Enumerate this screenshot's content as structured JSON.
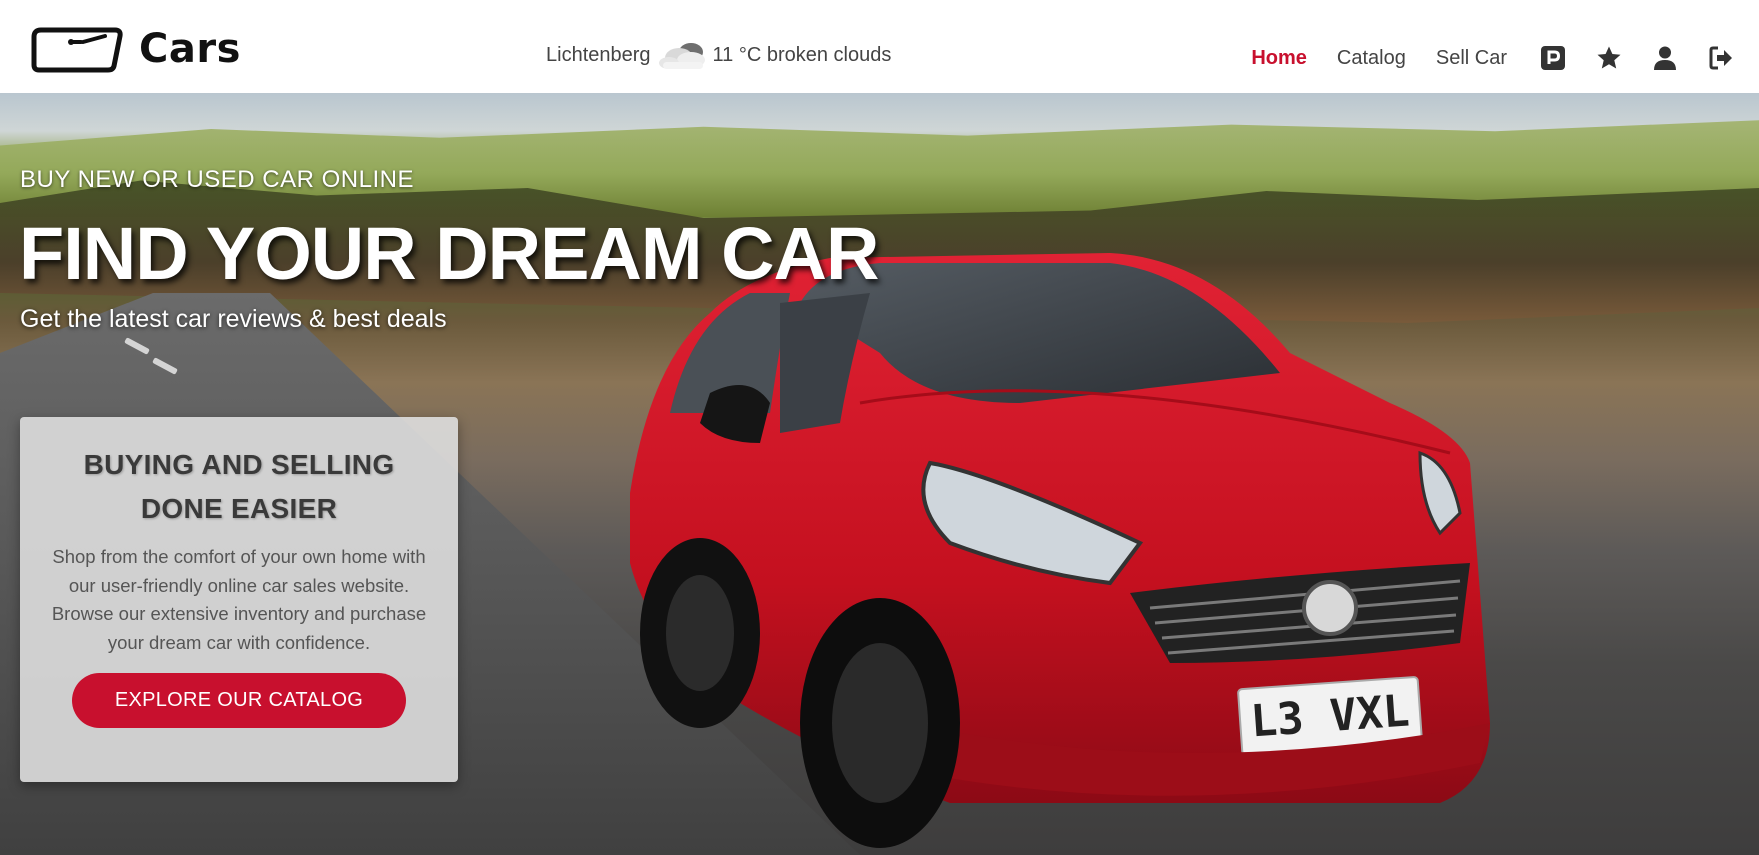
{
  "brand": {
    "name": "Cars",
    "logo_icon": "windshield-icon"
  },
  "weather": {
    "location": "Lichtenberg",
    "icon": "broken-clouds-icon",
    "description": "11 °C broken clouds"
  },
  "nav": {
    "links": [
      {
        "label": "Home",
        "active": true
      },
      {
        "label": "Catalog",
        "active": false
      },
      {
        "label": "Sell Car",
        "active": false
      }
    ],
    "icons": [
      "parking-icon",
      "star-icon",
      "user-icon",
      "logout-icon"
    ]
  },
  "hero": {
    "eyebrow": "BUY NEW OR USED CAR ONLINE",
    "title": "FIND YOUR DREAM CAR",
    "subtitle": "Get the latest car reviews & best deals",
    "plate": "L3 VXL"
  },
  "promo": {
    "title_line1": "BUYING AND SELLING",
    "title_line2": "DONE EASIER",
    "text": "Shop from the comfort of your own home with our user-friendly online car sales website. Browse our extensive inventory and purchase your dream car with confidence.",
    "button_label": "EXPLORE OUR CATALOG"
  },
  "colors": {
    "accent": "#c8102e",
    "text": "#444444",
    "card_bg": "#dedede"
  }
}
